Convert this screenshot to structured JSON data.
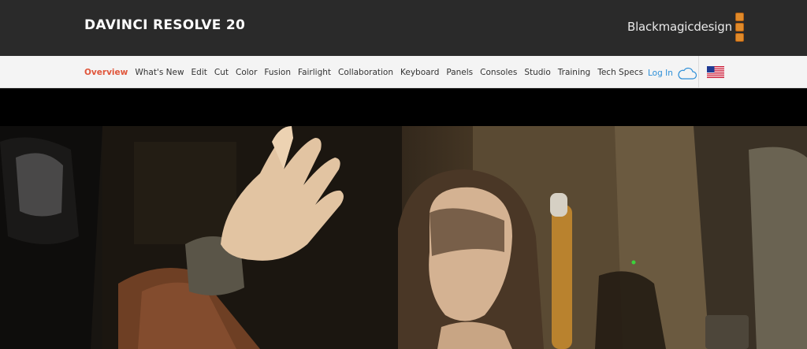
{
  "header": {
    "product_title": "DAVINCI RESOLVE 20",
    "brand_name": "Blackmagicdesign",
    "brand_color": "#e08a2a"
  },
  "nav": {
    "items": [
      {
        "label": "Overview",
        "active": true
      },
      {
        "label": "What's New",
        "active": false
      },
      {
        "label": "Edit",
        "active": false
      },
      {
        "label": "Cut",
        "active": false
      },
      {
        "label": "Color",
        "active": false
      },
      {
        "label": "Fusion",
        "active": false
      },
      {
        "label": "Fairlight",
        "active": false
      },
      {
        "label": "Collaboration",
        "active": false
      },
      {
        "label": "Keyboard",
        "active": false
      },
      {
        "label": "Panels",
        "active": false
      },
      {
        "label": "Consoles",
        "active": false
      },
      {
        "label": "Studio",
        "active": false
      },
      {
        "label": "Training",
        "active": false
      },
      {
        "label": "Tech Specs",
        "active": false
      }
    ],
    "active_color": "#e0553a",
    "login_label": "Log In",
    "login_icon": "cloud-icon",
    "region_icon": "us-flag-icon"
  },
  "hero": {
    "image_icon": "hero-image"
  }
}
